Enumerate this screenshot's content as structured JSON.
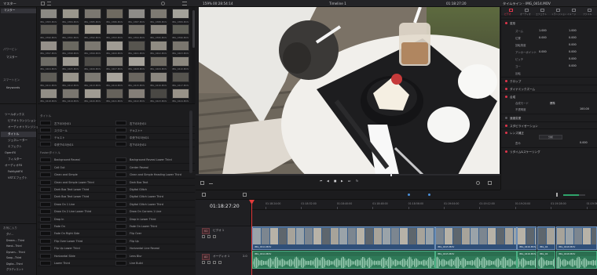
{
  "topbar": {
    "media_pool_label": "マスター",
    "zoom": "159%",
    "source_timecode": "00:28:54:14",
    "timeline_name": "Timeline 1",
    "record_timecode": "01:18:27:20",
    "inspector_title": "タイムライン - IMG_0414.MOV"
  },
  "media_sidebar": {
    "root": "マスター",
    "section_power_bins": "パワービン",
    "power_bin_master": "マスター",
    "section_smart_bins": "スマートビン",
    "smart_bin_keywords": "Keywords"
  },
  "media_clips": [
    {
      "name": "IMG_0383.MOV",
      "color": "#8c8a84"
    },
    {
      "name": "IMG_0384.MOV",
      "color": "#9a968c"
    },
    {
      "name": "IMG_0385.MOV",
      "color": "#7b7770"
    },
    {
      "name": "IMG_0386.MOV",
      "color": "#6f6a60"
    },
    {
      "name": "IMG_0387.MOV",
      "color": "#8e8c88"
    },
    {
      "name": "IMG_0388.MOV",
      "color": "#7e7a72"
    },
    {
      "name": "IMG_0389.MOV",
      "color": "#a4a29a"
    },
    {
      "name": "IMG_0390.MOV",
      "color": "#5c5a54"
    },
    {
      "name": "IMG_0391.MOV",
      "color": "#6c6860"
    },
    {
      "name": "IMG_0392.MOV",
      "color": "#9c968a"
    },
    {
      "name": "IMG_0393.MOV",
      "color": "#84807a"
    },
    {
      "name": "IMG_0394.MOV",
      "color": "#76726a"
    },
    {
      "name": "IMG_0395.MOV",
      "color": "#8a867e"
    },
    {
      "name": "IMG_0396.MOV",
      "color": "#606058"
    },
    {
      "name": "IMG_0397.MOV",
      "color": "#95908a"
    },
    {
      "name": "IMG_0398.MOV",
      "color": "#6a6860"
    },
    {
      "name": "IMG_0399.MOV",
      "color": "#7c7870"
    },
    {
      "name": "IMG_0400.MOV",
      "color": "#a09c94"
    },
    {
      "name": "IMG_0401.MOV",
      "color": "#57554f"
    },
    {
      "name": "IMG_0402.MOV",
      "color": "#8f8b82"
    },
    {
      "name": "IMG_0403.MOV",
      "color": "#7a766e"
    },
    {
      "name": "IMG_0404.MOV",
      "color": "#6e6c66"
    },
    {
      "name": "IMG_0405.MOV",
      "color": "#9d9991"
    },
    {
      "name": "IMG_0406.MOV",
      "color": "#4e4c48"
    },
    {
      "name": "IMG_0407.MOV",
      "color": "#837f78"
    },
    {
      "name": "IMG_0408.MOV",
      "color": "#a6a29a"
    },
    {
      "name": "IMG_0409.MOV",
      "color": "#706c64"
    },
    {
      "name": "IMG_0410.MOV",
      "color": "#8c887f"
    },
    {
      "name": "IMG_0411.MOV",
      "color": "#5f5d57"
    },
    {
      "name": "IMG_0412.MOV",
      "color": "#98948b"
    },
    {
      "name": "IMG_0413.MOV",
      "color": "#7d7a73"
    },
    {
      "name": "IMG_0414.MOV",
      "color": "#a8a49c"
    },
    {
      "name": "IMG_0415.MOV",
      "color": "#6a665f"
    },
    {
      "name": "IMG_0416.MOV",
      "color": "#8b877f"
    },
    {
      "name": "IMG_0417.MOV",
      "color": "#56544e"
    },
    {
      "name": "IMG_0418.MOV",
      "color": "#928e86"
    },
    {
      "name": "IMG_0419.MOV",
      "color": "#7a766f"
    },
    {
      "name": "IMG_0420.MOV",
      "color": "#a09b92"
    },
    {
      "name": "IMG_0421.MOV",
      "color": "#66625b"
    },
    {
      "name": "IMG_0422.MOV",
      "color": "#857f78"
    },
    {
      "name": "IMG_0423.MOV",
      "color": "#4a4844"
    },
    {
      "name": "IMG_0424.MOV",
      "color": "#989288"
    },
    {
      "name": "IMG_0425.MOV",
      "color": "#7e7971"
    },
    {
      "name": "IMG_0426.MOV",
      "color": "#6b675f"
    },
    {
      "name": "IMG_0427.MOV",
      "color": "#8d8981"
    },
    {
      "name": "IMG_0428.MOV",
      "color": "#5b5953"
    },
    {
      "name": "IMG_0429.MOV",
      "color": "#9e9a92"
    },
    {
      "name": "IMG_0430.MOV",
      "color": "#74706a"
    }
  ],
  "fx_sidebar": {
    "toolbox": "ツールボックス",
    "video_transitions": "ビデオトランジション",
    "audio_transitions": "オーディオトランジション",
    "titles": "タイトル",
    "generators": "ジェネレーター",
    "effects": "エフェクト",
    "open_fx": "OpenFX",
    "filters": "フィルター",
    "audio_fx": "オーディオFX",
    "fairlight_fx": "FairlightFX",
    "vst": "VSTエフェクト"
  },
  "fx_favorites": {
    "header": "お気に入り",
    "items": [
      "ダイ...",
      "Dream... Third",
      "Hand...Third",
      "Dynam... Third",
      "Soap...Third",
      "Digita...Third",
      "グラディエント"
    ]
  },
  "fx_titles": {
    "header": "タイトル",
    "left": [
      "左下の3分の1",
      "スクロール",
      "テキスト",
      "中央下の3分の1"
    ],
    "right": [
      "右下の3分の1",
      "テキスト+",
      "中央下の3分の1",
      "右下の3分の1"
    ]
  },
  "fusion_titles": {
    "header": "Fusionタイトル",
    "left": [
      "Background Reveal",
      "Call Out",
      "Clean and Simple",
      "Clean and Simple Lower Third",
      "Dark Box Text Lower Third",
      "Dark Box Text Lower Third",
      "Draw On 1 Line",
      "Draw On 2 Line Lower Third",
      "Drop In",
      "Fade On",
      "Fade On Right Side",
      "Flip Over Lower Third",
      "Flip Up Lower Third",
      "Horizontal Slide",
      "Lower Third"
    ],
    "right": [
      "Background Reveal Lower Third",
      "Center Reveal",
      "Clean and Simple Heading Lower Third",
      "Dark Box Text",
      "Digital Glitch",
      "Digital Glitch Lower Third",
      "Digital Glitch Lower Third",
      "Draw On Corners 1 Line",
      "Drop In Lower Third",
      "Fade On Lower Third",
      "Flip Over",
      "Flip Up",
      "Horizontal Line Reveal",
      "Lens Blur",
      "Line Build"
    ]
  },
  "inspector": {
    "tabs": [
      "ビデオ",
      "オーディオ",
      "エフェクト",
      "トランジション",
      "イメージ",
      "ファイル"
    ],
    "transform": {
      "label": "変形",
      "zoom_label": "ズーム",
      "zoom_x": "1.000",
      "zoom_y": "1.000",
      "position_label": "位置",
      "position_x": "0.000",
      "position_y": "0.000",
      "rotation_label": "回転角度",
      "rotation": "0.000",
      "anchor_label": "アンカーポイント",
      "anchor_x": "0.000",
      "anchor_y": "0.000",
      "pitch_label": "ピッチ",
      "pitch": "0.000",
      "yaw_label": "ヨー",
      "yaw": "0.000",
      "flip_label": "反転"
    },
    "sections": [
      "クロップ",
      "ダイナミックズーム",
      "合成"
    ],
    "composite": {
      "mode_label": "合成モード",
      "mode": "標準",
      "opacity_label": "不透明度",
      "opacity": "100.00"
    },
    "sections2": [
      "速度変更",
      "スタビライゼーション",
      "レンズ補正"
    ],
    "lens": {
      "analyze": "分析",
      "distortion_label": "歪み",
      "distortion": "0.000"
    },
    "sections3": [
      "リタイム&スケーリング"
    ]
  },
  "timeline": {
    "timecode": "01:18:27:20",
    "ruler_labels": [
      "01:18:24:00",
      "01:18:32:00",
      "01:18:40:00",
      "01:18:48:00",
      "01:18:56:00",
      "01:19:04:00",
      "01:19:12:00",
      "01:19:20:00",
      "01:19:28:00",
      "01:19:36:00"
    ],
    "video_track": {
      "id": "V1",
      "name": "ビデオ 1"
    },
    "audio_track": {
      "id": "A1",
      "name": "オーディオ 1",
      "level": "2.0"
    },
    "video_clips": [
      {
        "name": "IMG_0414.MOV"
      },
      {
        "name": "IMG_0415.MOV"
      },
      {
        "name": "IMG_0416.MOV"
      },
      {
        "name": "IMG_04"
      },
      {
        "name": "IMG_0418.MOV"
      }
    ],
    "audio_clips": [
      {
        "name": "IMG_0414.MOV"
      },
      {
        "name": "IMG_0415.MOV"
      },
      {
        "name": "IMG_0416.MOV"
      },
      {
        "name": "IMG_04"
      },
      {
        "name": "IMG_0418.MOV"
      }
    ]
  },
  "colors": {
    "accent": "#e0354b",
    "video_clip": "#3a5f8a",
    "audio_clip": "#2f7a58",
    "playhead": "#e23a3a"
  }
}
